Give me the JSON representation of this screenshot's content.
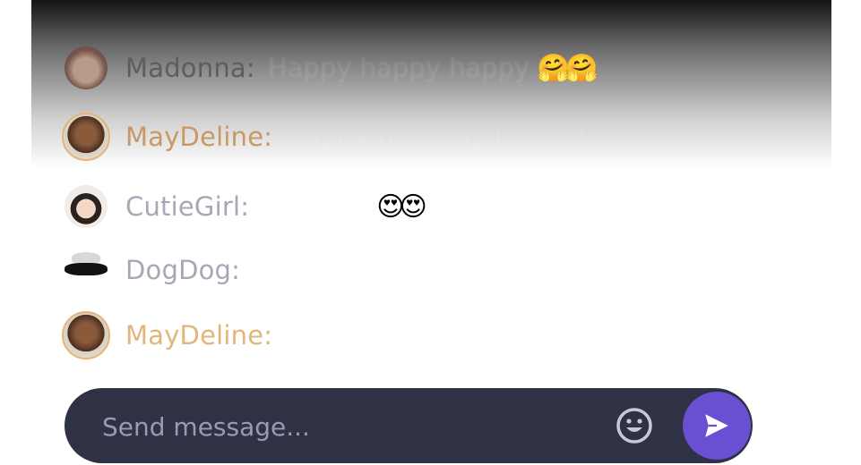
{
  "colors": {
    "gold_name": "#e2b67a",
    "gray_name": "#a9a7b5",
    "composer_bg": "#2f3145",
    "send_bg": "#6a4fd3"
  },
  "messages": [
    {
      "name": "Madonna:",
      "text": "Happy happy happy",
      "emoji": "🤗🤗",
      "avatar": "photo",
      "color": "#5d5d5d"
    },
    {
      "name": "MayDeline:",
      "text": "Happy birthday to you!",
      "emoji": "",
      "avatar": "photo",
      "color": "#c79a63"
    },
    {
      "name": "CutieGirl:",
      "text": "",
      "emoji": "😍😍",
      "avatar": "photo",
      "color": "#a9a7b5"
    },
    {
      "name": "DogDog:",
      "text": "",
      "emoji": "",
      "avatar": "dog",
      "color": "#a9a7b5"
    },
    {
      "name": "MayDeline:",
      "text": "",
      "emoji": "",
      "avatar": "photo",
      "color": "#e2b67a"
    }
  ],
  "composer": {
    "placeholder": "Send message...",
    "emoji_icon": "smiley-icon",
    "send_icon": "send-icon"
  }
}
